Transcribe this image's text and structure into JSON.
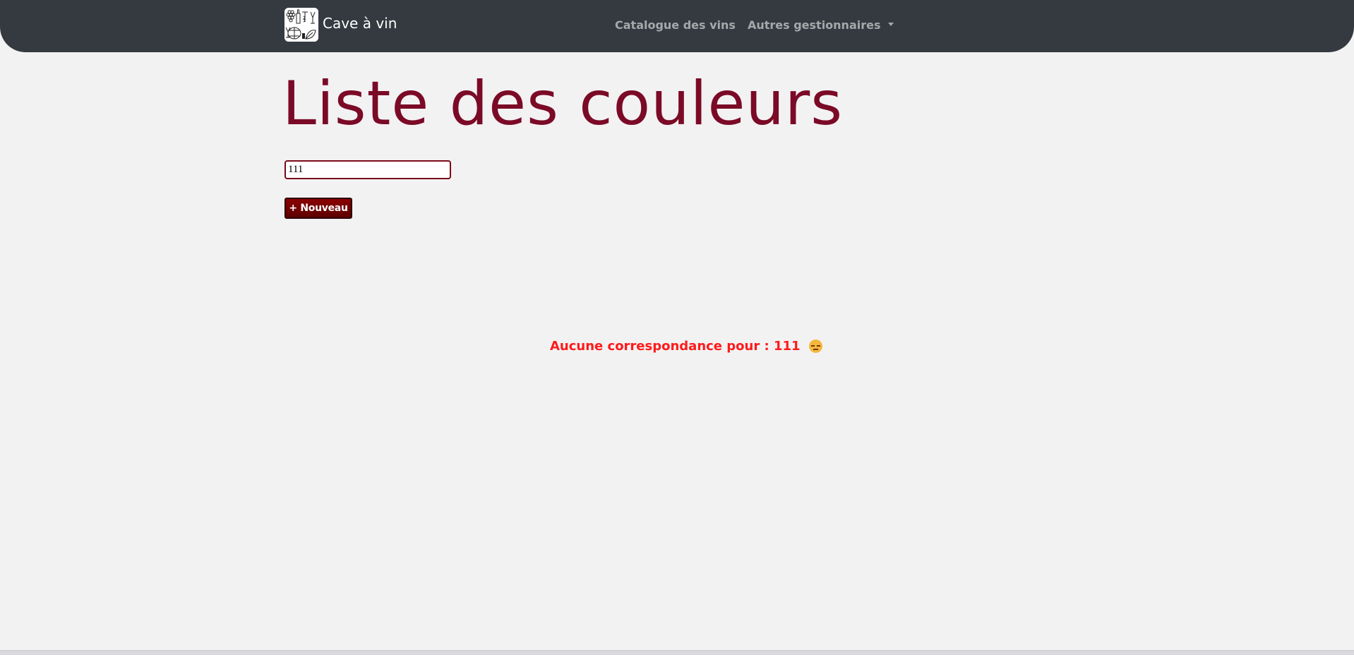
{
  "navbar": {
    "brand_text": "Cave à vin",
    "links": [
      {
        "label": "Catalogue des vins"
      },
      {
        "label": "Autres gestionnaires"
      }
    ]
  },
  "main": {
    "title": "Liste des couleurs",
    "search": {
      "value": "111"
    },
    "new_button_label": "+ Nouveau",
    "empty_message": "Aucune correspondance pour : 111"
  },
  "colors": {
    "navbar_bg": "#343a40",
    "title": "#7b0a26",
    "accent_button": "#7a0000",
    "empty_message": "#ff1a1a",
    "page_bg": "#f3f2f3"
  },
  "icons": [
    "cave-logo-icon",
    "dropdown-caret-icon",
    "sad-face-icon"
  ]
}
